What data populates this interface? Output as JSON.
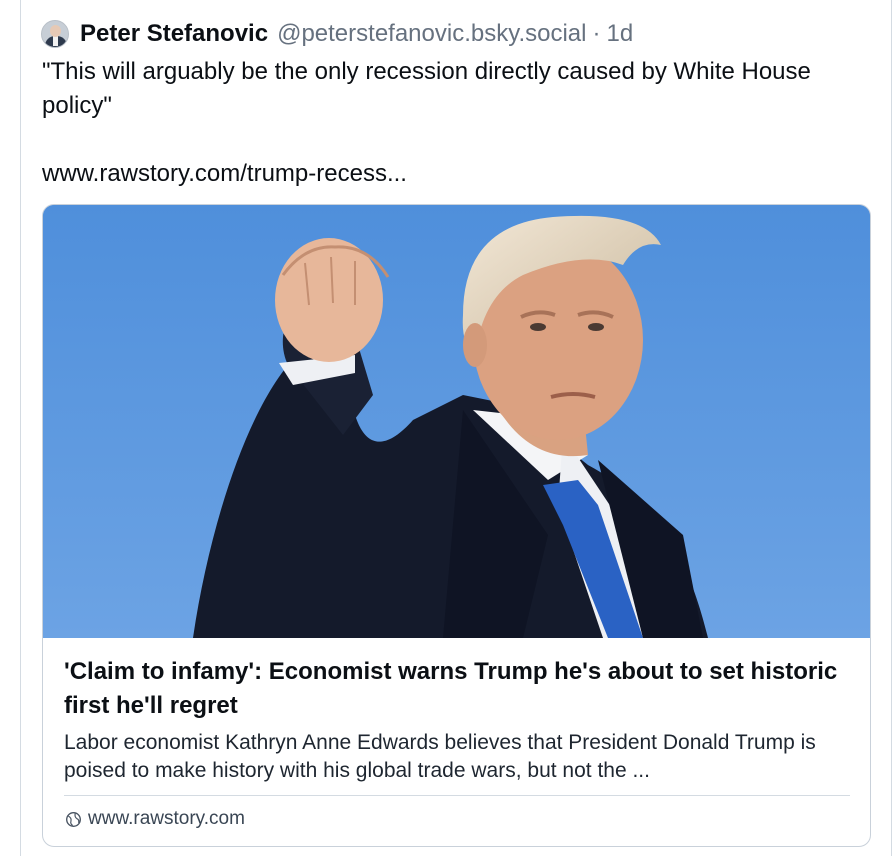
{
  "post": {
    "author": "Peter Stefanovic",
    "handle": "@peterstefanovic.bsky.social",
    "separator": "·",
    "time": "1d",
    "quote": "\"This will arguably be the only recession directly caused by White House policy\"",
    "link": "www.rawstory.com/trump-recess...",
    "avatar_icon": "user-avatar"
  },
  "card": {
    "title": "'Claim to infamy': Economist warns Trump he's about to set historic first he'll regret",
    "description": "Labor economist Kathryn Anne Edwards believes that President Donald Trump is poised to make history with his global trade wars, but not the ...",
    "domain": "www.rawstory.com",
    "domain_icon": "globe-icon",
    "image_icon": "news-photo"
  },
  "colors": {
    "text": "#0b0f14",
    "muted": "#66717f",
    "border": "#d4dbe2",
    "sky": "#5b93d6"
  }
}
